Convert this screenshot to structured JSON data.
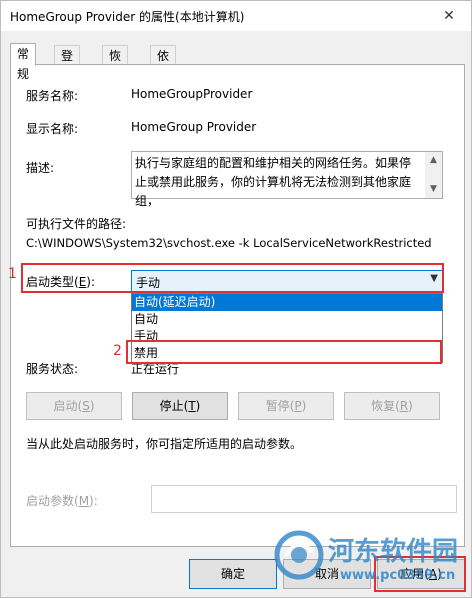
{
  "window": {
    "title": "HomeGroup Provider 的属性(本地计算机)",
    "close_glyph": "✕"
  },
  "tabs": [
    {
      "label": "常规"
    },
    {
      "label": "登录"
    },
    {
      "label": "恢复"
    },
    {
      "label": "依存关系"
    }
  ],
  "general": {
    "service_name_label": "服务名称:",
    "service_name": "HomeGroupProvider",
    "display_name_label": "显示名称:",
    "display_name": "HomeGroup Provider",
    "description_label": "描述:",
    "description": "执行与家庭组的配置和维护相关的网络任务。如果停止或禁用此服务，你的计算机将无法检测到其他家庭组，",
    "exe_path_label": "可执行文件的路径:",
    "exe_path": "C:\\WINDOWS\\System32\\svchost.exe -k LocalServiceNetworkRestricted",
    "startup_type_label_pre": "启动类型(",
    "startup_type_label_key": "E",
    "startup_type_label_post": "):",
    "startup_type_value": "手动",
    "startup_options": [
      "自动(延迟启动)",
      "自动",
      "手动",
      "禁用"
    ],
    "status_label": "服务状态:",
    "status_value": "正在运行",
    "hint": "当从此处启动服务时，你可指定所适用的启动参数。",
    "params_label_pre": "启动参数(",
    "params_label_key": "M",
    "params_label_post": "):",
    "params_value": ""
  },
  "service_buttons": {
    "start_pre": "启动(",
    "start_key": "S",
    "start_post": ")",
    "stop_pre": "停止(",
    "stop_key": "T",
    "stop_post": ")",
    "pause_pre": "暂停(",
    "pause_key": "P",
    "pause_post": ")",
    "resume_pre": "恢复(",
    "resume_key": "R",
    "resume_post": ")"
  },
  "footer": {
    "ok": "确定",
    "cancel": "取消",
    "apply_pre": "应用(",
    "apply_key": "A",
    "apply_post": ")"
  },
  "annotations": [
    "1",
    "2"
  ],
  "watermark": {
    "text": "河东软件园",
    "url": "www.pc0359.cn"
  },
  "colors": {
    "accent": "#0078d7",
    "annotation": "#e03030",
    "watermark": "#2f86c8"
  },
  "icons": {
    "combo_arrow": "chevron-down-icon",
    "scroll_up": "arrow-up-icon",
    "scroll_down": "arrow-down-icon",
    "close": "close-icon"
  }
}
